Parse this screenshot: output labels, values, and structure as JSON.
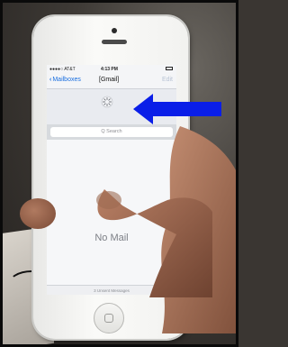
{
  "status": {
    "carrier": "●●●●○ AT&T",
    "time": "4:13 PM"
  },
  "nav": {
    "back_label": "Mailboxes",
    "title": "[Gmail]",
    "edit_label": "Edit"
  },
  "search": {
    "placeholder": "Q Search"
  },
  "empty_state": {
    "text": "No Mail"
  },
  "toolbar": {
    "text": "3 Unsent Messages"
  },
  "colors": {
    "ios_blue": "#1a6fe0",
    "arrow_blue": "#0a1ee8",
    "phone_body": "#f5f5f3"
  },
  "icons": [
    "back-chevron-icon",
    "refresh-spinner-icon",
    "compose-icon",
    "arrow-icon",
    "home-button-icon"
  ]
}
